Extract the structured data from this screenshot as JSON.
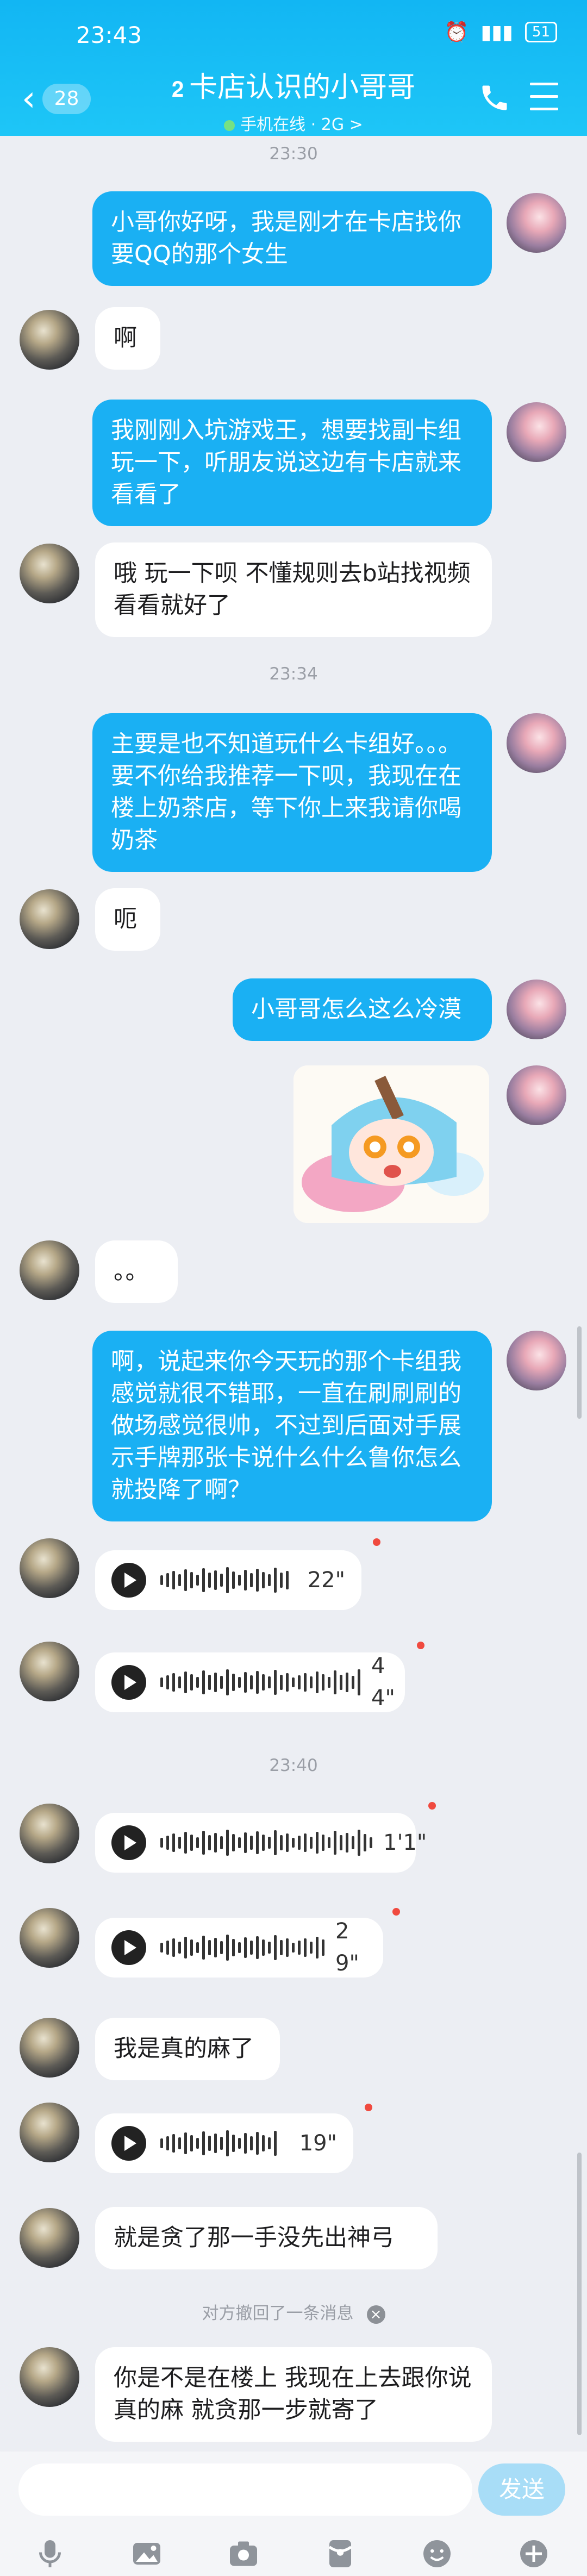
{
  "status_bar": {
    "time": "23:43",
    "battery": "51"
  },
  "header": {
    "unread_count": "28",
    "title": "卡店认识的小哥哥",
    "presence": "手机在线 · 2G >"
  },
  "timestamps": [
    "23:30",
    "23:34",
    "23:40"
  ],
  "messages": [
    {
      "side": "out",
      "text": "小哥你好呀，我是刚才在卡店找你要QQ的那个女生"
    },
    {
      "side": "in",
      "text": "啊"
    },
    {
      "side": "out",
      "text": "我刚刚入坑游戏王，想要找副卡组玩一下，听朋友说这边有卡店就来看看了"
    },
    {
      "side": "in",
      "text": "哦 玩一下呗 不懂规则去b站找视频看看就好了"
    },
    {
      "side": "out",
      "text": "主要是也不知道玩什么卡组好。。。要不你给我推荐一下呗，我现在在楼上奶茶店，等下你上来我请你喝奶茶"
    },
    {
      "side": "in",
      "text": "呃"
    },
    {
      "side": "out",
      "text": "小哥哥怎么这么冷漠"
    },
    {
      "side": "in",
      "text": "。。"
    },
    {
      "side": "out",
      "text": "啊，说起来你今天玩的那个卡组我感觉就很不错耶，一直在刷刷刷的做场感觉很帅，不过到后面对手展示手牌那张卡说什么什么鲁你怎么就投降了啊？"
    },
    {
      "side": "in",
      "text": "我是真的麻了"
    },
    {
      "side": "in",
      "text": "就是贪了那一手没先出神弓"
    },
    {
      "side": "in",
      "text": "你是不是在楼上 我现在上去跟你说 真的麻 就贪那一步就寄了"
    }
  ],
  "voice_messages": [
    {
      "duration": "22\""
    },
    {
      "duration": "44\""
    },
    {
      "duration": "1'1\""
    },
    {
      "duration": "29\""
    },
    {
      "duration": "19\""
    }
  ],
  "recall_notice": "对方撤回了一条消息",
  "input_bar": {
    "send_label": "发送"
  },
  "colors": {
    "header": "#12b6f3",
    "outgoing_bubble": "#1ab0f3",
    "unread_dot": "#f04a3f"
  },
  "icons": [
    "back-arrow-icon",
    "ear-icon",
    "phone-icon",
    "menu-icon",
    "play-icon",
    "mic-icon",
    "image-icon",
    "camera-icon",
    "red-packet-icon",
    "emoji-icon",
    "plus-icon"
  ]
}
